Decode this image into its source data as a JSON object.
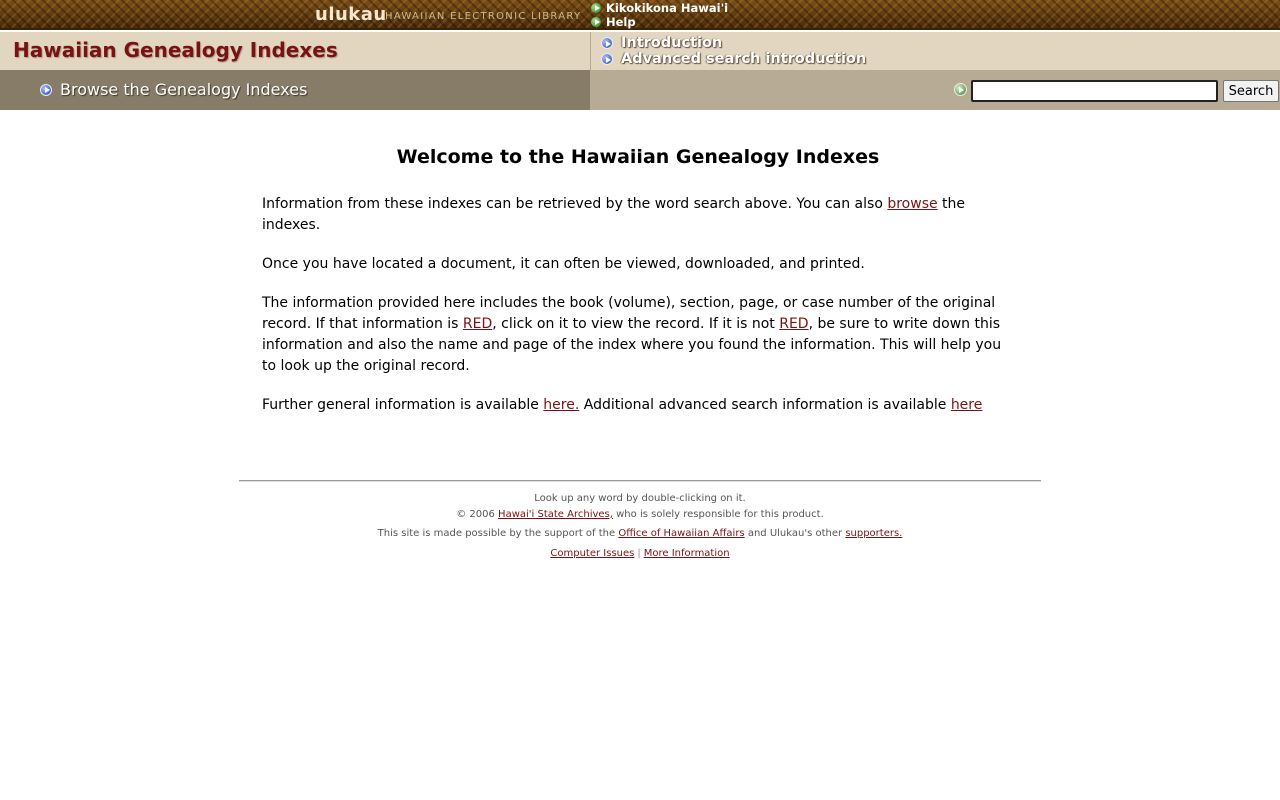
{
  "header": {
    "logo_text": "ulukau",
    "logo_subtitle": "HAWAIIAN ELECTRONIC LIBRARY",
    "top_links": [
      "Kikokikona Hawai'i",
      "Help"
    ]
  },
  "title_bar": {
    "site_title": "Hawaiian Genealogy Indexes",
    "links": [
      "Introduction",
      "Advanced search introduction"
    ]
  },
  "nav": {
    "browse_label": "Browse the Genealogy Indexes",
    "search_value": "",
    "search_button": "Search"
  },
  "main": {
    "heading": "Welcome to the Hawaiian Genealogy Indexes",
    "p1": {
      "before": "Information from these indexes can be retrieved by the word search above. You can also ",
      "link": "browse",
      "after": " the indexes."
    },
    "p2": "Once you have located a document, it can often be viewed, downloaded, and printed.",
    "p3": {
      "part1": "The information provided here includes the book (volume), section, page, or case number of the original record. If that information is ",
      "link1": "RED",
      "part2": ", click on it to view the record. If it is not ",
      "link2": "RED",
      "part3": ", be sure to write down this information and also the name and page of the index where you found the information. This will help you to look up the original record."
    },
    "p4": {
      "part1": "Further general information is available ",
      "link1": "here.",
      "part2": " Additional advanced search information is available ",
      "link2": "here"
    }
  },
  "footer": {
    "line1": "Look up any word by double-clicking on it.",
    "line2_prefix": "© 2006 ",
    "line2_link": "Hawai'i State Archives,",
    "line2_suffix": " who is solely responsible for this product.",
    "line3_prefix": "This site is made possible by the support of the ",
    "line3_link1": "Office of Hawaiian Affairs",
    "line3_mid": " and Ulukau's other ",
    "line3_link2": "supporters.",
    "links": [
      "Computer Issues",
      "More Information"
    ],
    "separator": "|"
  },
  "colors": {
    "accent_red": "#7a1212",
    "title_bar_bg": "#e2d6c1",
    "nav_left_bg": "#877c68",
    "nav_right_bg": "#b7ab95"
  }
}
